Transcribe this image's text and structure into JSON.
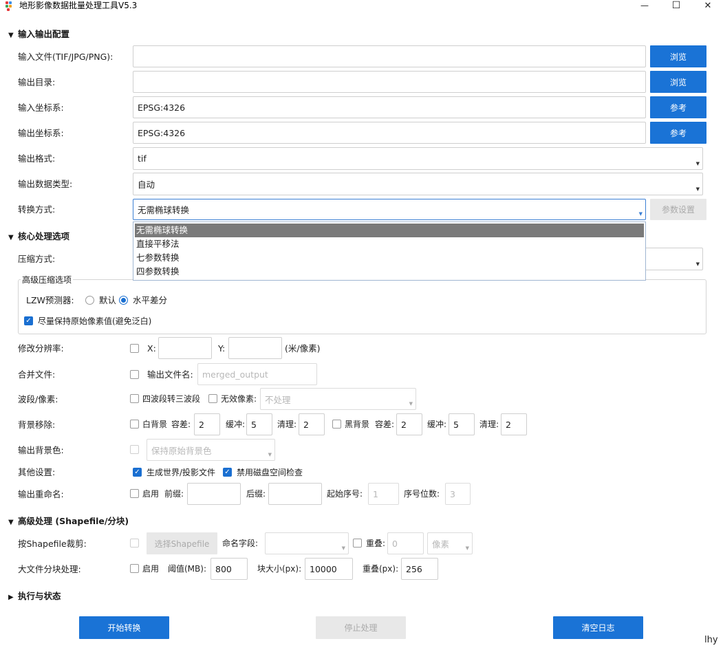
{
  "window": {
    "title": "地形影像数据批量处理工具V5.3",
    "minimize": "—",
    "maximize": "☐",
    "close": "✕"
  },
  "sections": {
    "io": "输入输出配置",
    "core": "核心处理选项",
    "advanced": "高级处理 (Shapefile/分块)",
    "exec": "执行与状态"
  },
  "io": {
    "input_label": "输入文件(TIF/JPG/PNG):",
    "input_value": "",
    "browse1": "浏览",
    "output_label": "输出目录:",
    "output_value": "",
    "browse2": "浏览",
    "in_crs_label": "输入坐标系:",
    "in_crs_value": "EPSG:4326",
    "ref1": "参考",
    "out_crs_label": "输出坐标系:",
    "out_crs_value": "EPSG:4326",
    "ref2": "参考",
    "format_label": "输出格式:",
    "format_value": "tif",
    "dtype_label": "输出数据类型:",
    "dtype_value": "自动",
    "transform_label": "转换方式:",
    "transform_value": "无需椭球转换",
    "params_button": "参数设置",
    "transform_options": [
      "无需椭球转换",
      "直接平移法",
      "七参数转换",
      "四参数转换"
    ]
  },
  "core": {
    "compress_label": "压缩方式:",
    "group_title": "高级压缩选项",
    "lzw_label": "LZW预测器:",
    "radio_default": "默认",
    "radio_horizontal": "水平差分",
    "keep_pixels": "尽量保持原始像素值(避免泛白)",
    "resolution_label": "修改分辨率:",
    "x_label": "X:",
    "y_label": "Y:",
    "res_unit": "(米/像素)",
    "merge_label": "合并文件:",
    "merge_name_label": "输出文件名:",
    "merge_placeholder": "merged_output",
    "band_label": "波段/像素:",
    "four_to_three": "四波段转三波段",
    "invalid_pixel": "无效像素:",
    "invalid_value": "不处理",
    "bg_label": "背景移除:",
    "white_bg": "白背景",
    "black_bg": "黑背景",
    "tolerance": "容差:",
    "buffer": "缓冲:",
    "clean": "清理:",
    "white_tol": "2",
    "white_buf": "5",
    "white_clean": "2",
    "black_tol": "2",
    "black_buf": "5",
    "black_clean": "2",
    "out_bg_label": "输出背景色:",
    "out_bg_value": "保持原始背景色",
    "other_label": "其他设置:",
    "world_file": "生成世界/投影文件",
    "disk_check": "禁用磁盘空间检查",
    "rename_label": "输出重命名:",
    "enable": "启用",
    "prefix": "前缀:",
    "suffix": "后缀:",
    "start_num": "起始序号:",
    "start_value": "1",
    "digits": "序号位数:",
    "digits_value": "3"
  },
  "advanced": {
    "clip_label": "按Shapefile裁剪:",
    "select_shp": "选择Shapefile",
    "name_field": "命名字段:",
    "overlap": "重叠:",
    "overlap_value": "0",
    "unit": "像素",
    "tile_label": "大文件分块处理:",
    "enable": "启用",
    "threshold": "阈值(MB):",
    "threshold_value": "800",
    "block": "块大小(px):",
    "block_value": "10000",
    "tile_overlap": "重叠(px):",
    "tile_overlap_value": "256"
  },
  "actions": {
    "start": "开始转换",
    "stop": "停止处理",
    "clear": "清空日志"
  },
  "watermark": "lhy",
  "colors": {
    "accent": "#1a73d6",
    "dropdown_selected": "#7a7a7a"
  }
}
